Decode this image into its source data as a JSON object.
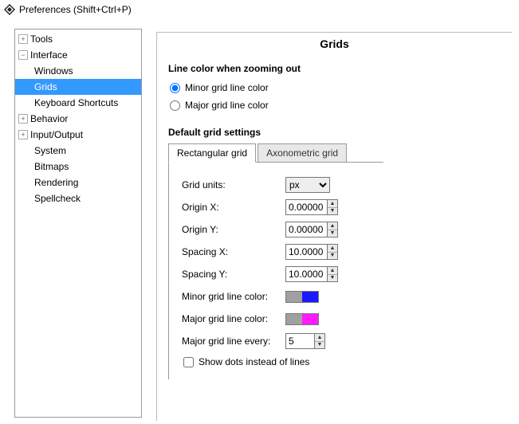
{
  "window": {
    "title": "Preferences (Shift+Ctrl+P)"
  },
  "tree": {
    "items": [
      {
        "label": "Tools",
        "depth": 0,
        "exp": "plus"
      },
      {
        "label": "Interface",
        "depth": 0,
        "exp": "minus"
      },
      {
        "label": "Windows",
        "depth": 1
      },
      {
        "label": "Grids",
        "depth": 1,
        "selected": true
      },
      {
        "label": "Keyboard Shortcuts",
        "depth": 1
      },
      {
        "label": "Behavior",
        "depth": 0,
        "exp": "plus"
      },
      {
        "label": "Input/Output",
        "depth": 0,
        "exp": "plus"
      },
      {
        "label": "System",
        "depth": 1
      },
      {
        "label": "Bitmaps",
        "depth": 1
      },
      {
        "label": "Rendering",
        "depth": 1
      },
      {
        "label": "Spellcheck",
        "depth": 1
      }
    ]
  },
  "panel": {
    "title": "Grids",
    "zoom_heading": "Line color when zooming out",
    "radio_minor": "Minor grid line color",
    "radio_major": "Major grid line color",
    "default_heading": "Default grid settings",
    "tab_rect": "Rectangular grid",
    "tab_axo": "Axonometric grid",
    "fields": {
      "units_label": "Grid units:",
      "units_value": "px",
      "origin_x_label": "Origin X:",
      "origin_x_value": "0.00000",
      "origin_y_label": "Origin Y:",
      "origin_y_value": "0.00000",
      "spacing_x_label": "Spacing X:",
      "spacing_x_value": "10.0000",
      "spacing_y_label": "Spacing Y:",
      "spacing_y_value": "10.0000",
      "minor_color_label": "Minor grid line color:",
      "major_color_label": "Major grid line color:",
      "every_label": "Major grid line every:",
      "every_value": "5",
      "dots_label": "Show dots instead of lines"
    },
    "colors": {
      "minor_left": "#a0a0a0",
      "minor_right": "#1a1aff",
      "major_left": "#a0a0a0",
      "major_right": "#ff1aff"
    }
  }
}
